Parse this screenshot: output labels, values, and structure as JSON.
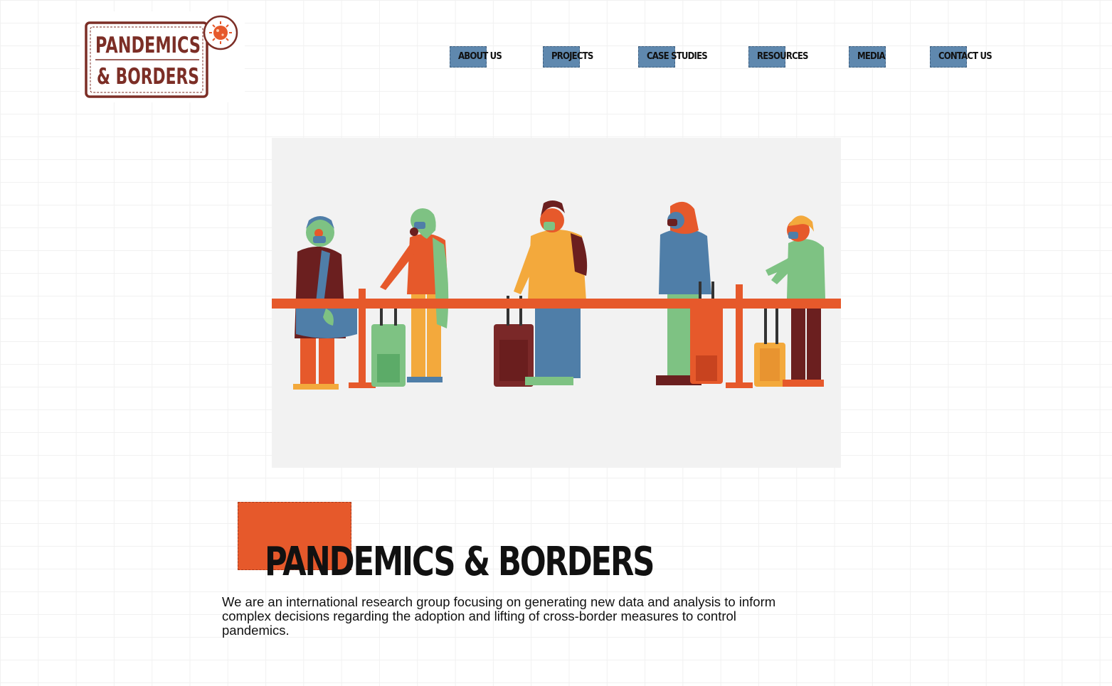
{
  "logo": {
    "line1": "PANDEMICS",
    "line2": "& BORDERS",
    "color": "#7c2e26",
    "virus_color": "#e6592b"
  },
  "nav": {
    "accent": "#5f88ae",
    "items": [
      {
        "label": "ABOUT US"
      },
      {
        "label": "PROJECTS"
      },
      {
        "label": "CASE STUDIES"
      },
      {
        "label": "RESOURCES"
      },
      {
        "label": "MEDIA"
      },
      {
        "label": "CONTACT US"
      }
    ]
  },
  "hero": {
    "icon": "queue-of-travelers-with-luggage-illustration",
    "background": "#f2f2f2",
    "barrier_color": "#e6592b"
  },
  "main": {
    "title": "PANDEMICS & BORDERS",
    "title_accent": "#e6592b",
    "intro": "We are an international research group focusing on generating new data and analysis to inform complex decisions regarding the adoption and lifting of cross-border measures to control pandemics."
  }
}
